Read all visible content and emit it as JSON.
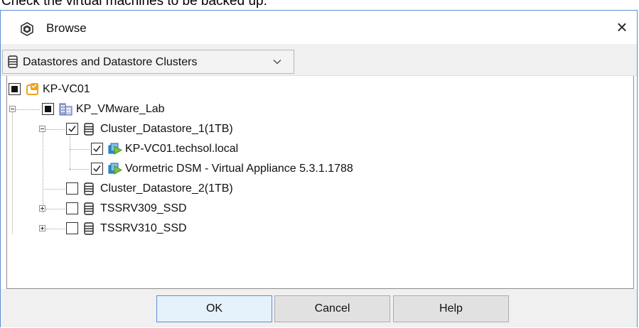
{
  "caption": "Check the virtual machines to be backed up:",
  "dialog": {
    "title": "Browse",
    "close_glyph": "×",
    "title_icon": "vmware-logo-icon"
  },
  "view_selector": {
    "selected": "Datastores and Datastore Clusters",
    "icon": "datastore-icon"
  },
  "tree": {
    "nodes": [
      {
        "label": "KP-VC01",
        "icon": "vcenter-icon",
        "check": "partial",
        "expander": "none"
      },
      {
        "label": "KP_VMware_Lab",
        "icon": "datacenter-icon",
        "check": "partial",
        "expander": "minus"
      },
      {
        "label": "Cluster_Datastore_1(1TB)",
        "icon": "datastore-icon",
        "check": "checked",
        "expander": "minus"
      },
      {
        "label": "KP-VC01.techsol.local",
        "icon": "vm-icon",
        "check": "checked",
        "expander": "none"
      },
      {
        "label": "Vormetric DSM - Virtual Appliance 5.3.1.1788",
        "icon": "vm-icon",
        "check": "checked",
        "expander": "none"
      },
      {
        "label": "Cluster_Datastore_2(1TB)",
        "icon": "datastore-icon",
        "check": "unchecked",
        "expander": "none"
      },
      {
        "label": "TSSRV309_SSD",
        "icon": "datastore-icon",
        "check": "unchecked",
        "expander": "plus"
      },
      {
        "label": "TSSRV310_SSD",
        "icon": "datastore-icon",
        "check": "unchecked",
        "expander": "plus"
      }
    ]
  },
  "buttons": {
    "ok": "OK",
    "cancel": "Cancel",
    "help": "Help"
  },
  "colors": {
    "dialog_border": "#5b8fd4",
    "toolbar_bg": "#f0f0f0",
    "vcenter_orange": "#f2a21b",
    "vm_green": "#7cc242",
    "vm_blue": "#2b8fd8"
  }
}
